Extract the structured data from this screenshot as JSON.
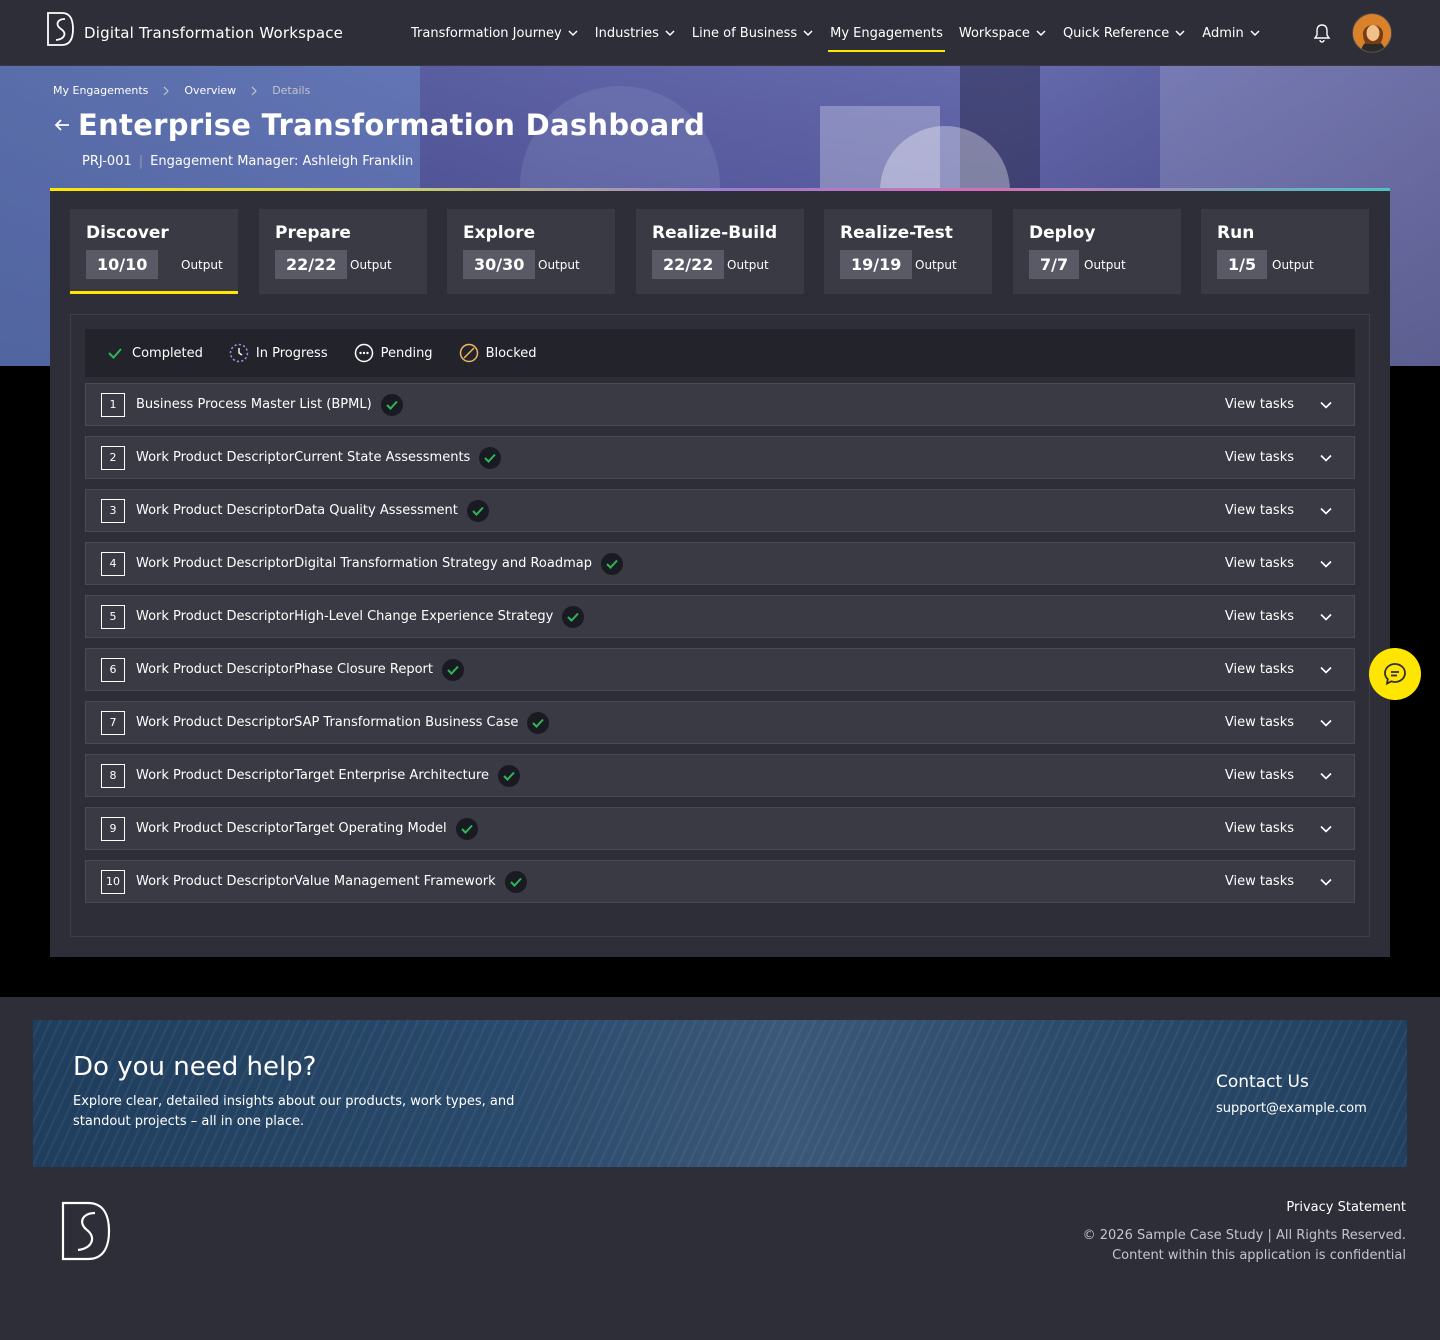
{
  "header": {
    "app_title": "Digital Transformation Workspace",
    "nav": [
      {
        "label": "Transformation Journey",
        "has_dropdown": true,
        "active": false
      },
      {
        "label": "Industries",
        "has_dropdown": true,
        "active": false
      },
      {
        "label": "Line of Business",
        "has_dropdown": true,
        "active": false
      },
      {
        "label": "My Engagements",
        "has_dropdown": false,
        "active": true
      },
      {
        "label": "Workspace",
        "has_dropdown": true,
        "active": false
      },
      {
        "label": "Quick Reference",
        "has_dropdown": true,
        "active": false
      },
      {
        "label": "Admin",
        "has_dropdown": true,
        "active": false
      }
    ],
    "icons": [
      "bell-icon",
      "avatar"
    ]
  },
  "breadcrumb": [
    "My Engagements",
    "Overview",
    "Details"
  ],
  "page": {
    "title": "Enterprise Transformation Dashboard",
    "project_id": "PRJ-001",
    "manager": "Engagement Manager: Ashleigh Franklin"
  },
  "phases": [
    {
      "name": "Discover",
      "count": "10/10",
      "label": "Output",
      "active": true
    },
    {
      "name": "Prepare",
      "count": "22/22",
      "label": "Output",
      "active": false
    },
    {
      "name": "Explore",
      "count": "30/30",
      "label": "Output",
      "active": false
    },
    {
      "name": "Realize-Build",
      "count": "22/22",
      "label": "Output",
      "active": false
    },
    {
      "name": "Realize-Test",
      "count": "19/19",
      "label": "Output",
      "active": false
    },
    {
      "name": "Deploy",
      "count": "7/7",
      "label": "Output",
      "active": false
    },
    {
      "name": "Run",
      "count": "1/5",
      "label": "Output",
      "active": false
    }
  ],
  "legend": [
    {
      "label": "Completed",
      "icon": "check-icon"
    },
    {
      "label": "In Progress",
      "icon": "in-progress-icon"
    },
    {
      "label": "Pending",
      "icon": "pending-icon"
    },
    {
      "label": "Blocked",
      "icon": "blocked-icon"
    }
  ],
  "deliverables": [
    {
      "num": "1",
      "title": "Business Process Master List (BPML)",
      "status": "completed",
      "action": "View tasks"
    },
    {
      "num": "2",
      "title": "Work Product DescriptorCurrent State Assessments",
      "status": "completed",
      "action": "View tasks"
    },
    {
      "num": "3",
      "title": "Work Product DescriptorData Quality Assessment",
      "status": "completed",
      "action": "View tasks"
    },
    {
      "num": "4",
      "title": "Work Product DescriptorDigital Transformation Strategy and Roadmap",
      "status": "completed",
      "action": "View tasks"
    },
    {
      "num": "5",
      "title": "Work Product DescriptorHigh-Level Change Experience Strategy",
      "status": "completed",
      "action": "View tasks"
    },
    {
      "num": "6",
      "title": "Work Product DescriptorPhase Closure Report",
      "status": "completed",
      "action": "View tasks"
    },
    {
      "num": "7",
      "title": "Work Product DescriptorSAP Transformation Business Case",
      "status": "completed",
      "action": "View tasks"
    },
    {
      "num": "8",
      "title": "Work Product DescriptorTarget Enterprise Architecture",
      "status": "completed",
      "action": "View tasks"
    },
    {
      "num": "9",
      "title": "Work Product DescriptorTarget Operating Model",
      "status": "completed",
      "action": "View tasks"
    },
    {
      "num": "10",
      "title": "Work Product DescriptorValue Management Framework",
      "status": "completed",
      "action": "View tasks"
    }
  ],
  "help": {
    "title": "Do you need help?",
    "text": "Explore clear, detailed insights about our products, work types, and standout projects – all in one place.",
    "contact_title": "Contact Us",
    "contact_email": "support@example.com"
  },
  "footer": {
    "privacy": "Privacy Statement",
    "copyright": "© 2026 Sample Case Study | All Rights Reserved.",
    "confidential": "Content within this application is confidential"
  },
  "colors": {
    "accent": "#ffe600",
    "background": "#2e2e38",
    "card": "#3a3a45",
    "success": "#2db757"
  }
}
